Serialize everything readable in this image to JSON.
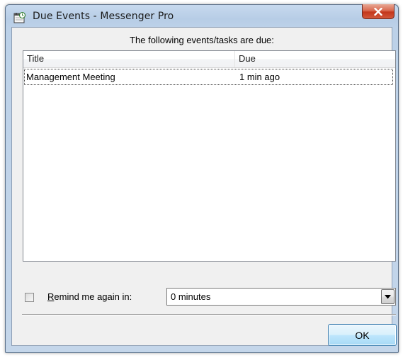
{
  "window": {
    "title": "Due Events - Messenger Pro",
    "close_glyph": "X"
  },
  "heading": "The following events/tasks are due:",
  "list": {
    "columns": [
      "Title",
      "Due"
    ],
    "rows": [
      {
        "title": "Management Meeting",
        "due": "1 min ago",
        "focused": true
      }
    ]
  },
  "remind": {
    "checked": false,
    "label_access_key": "R",
    "label_rest": "emind me again in:",
    "selected_value": "0 minutes"
  },
  "buttons": {
    "ok_label": "OK"
  },
  "icons": {
    "app_icon": "calendar-clock-icon",
    "close_icon": "close-icon",
    "dropdown_icon": "chevron-down-icon"
  },
  "colors": {
    "titlebar": "#bcd1e8",
    "close_button": "#c3361c",
    "dialog_background": "#f0f0f0",
    "ok_button": "#bee6fd"
  }
}
